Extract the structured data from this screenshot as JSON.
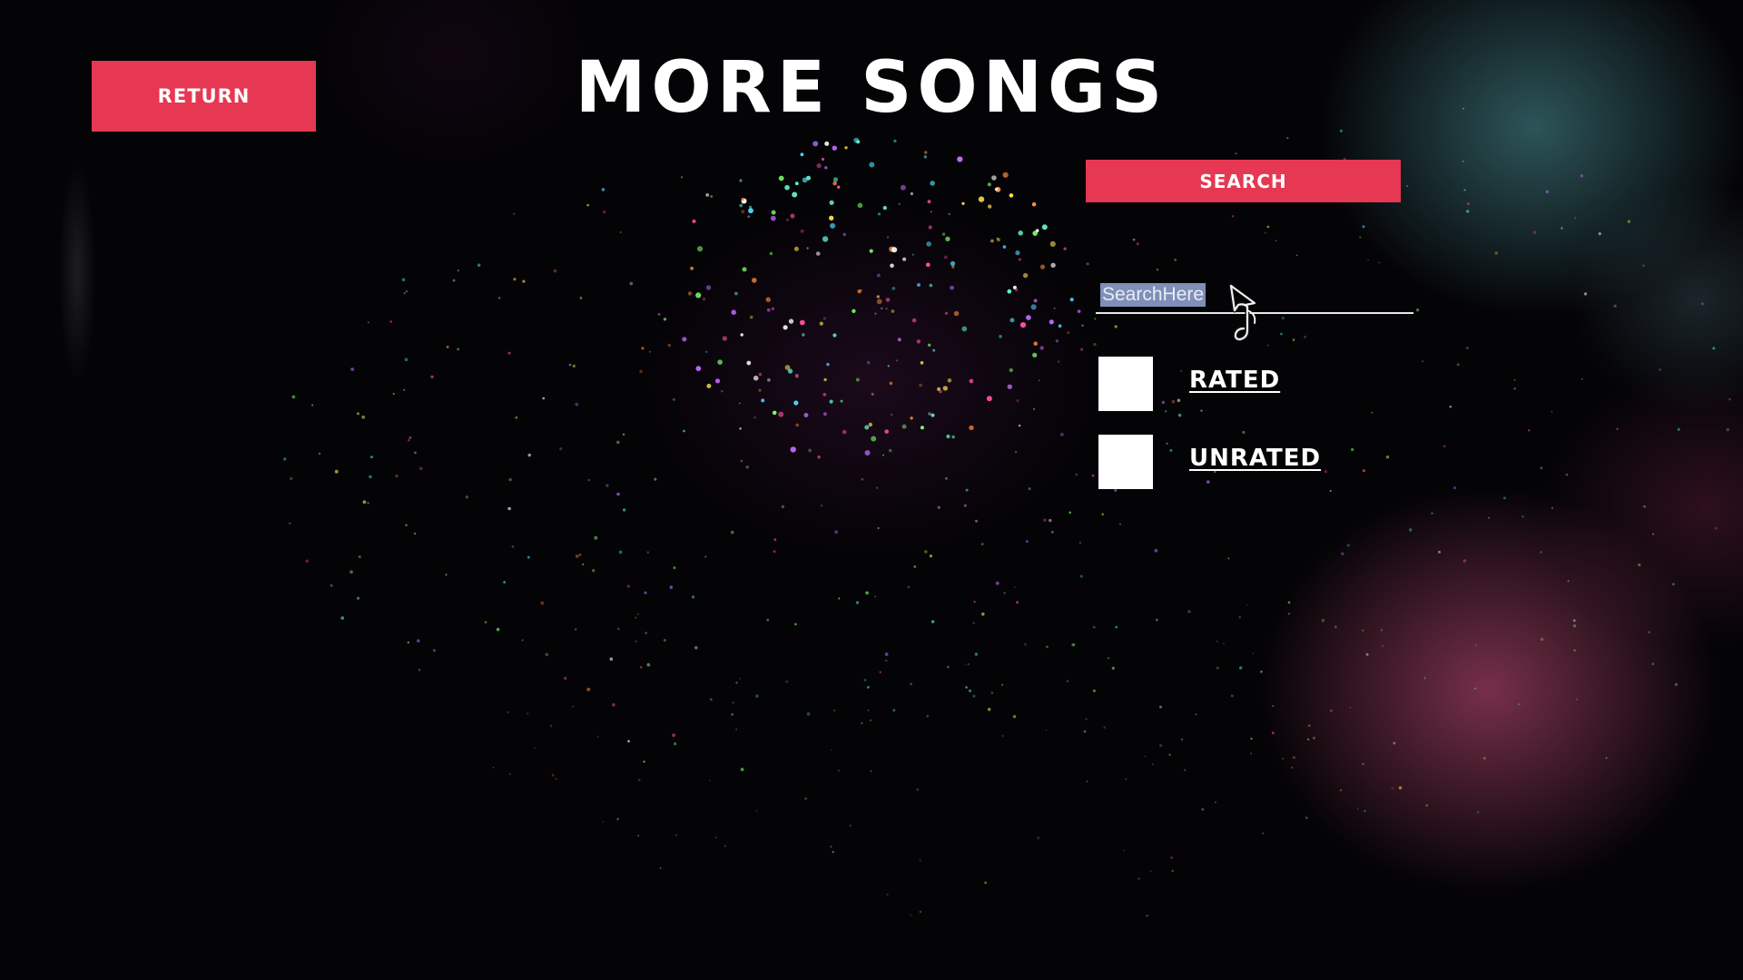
{
  "header": {
    "title": "MORE SONGS"
  },
  "buttons": {
    "return_label": "RETURN",
    "search_label": "SEARCH"
  },
  "search": {
    "value": "SearchHere"
  },
  "filters": [
    {
      "label": "RATED",
      "checked": false
    },
    {
      "label": "UNRATED",
      "checked": false
    }
  ],
  "colors": {
    "accent": "#e63852",
    "background": "#040306",
    "text": "#ffffff",
    "selection": "#7f8fb8"
  },
  "icons": {
    "cursor": "music-note-cursor-icon"
  }
}
